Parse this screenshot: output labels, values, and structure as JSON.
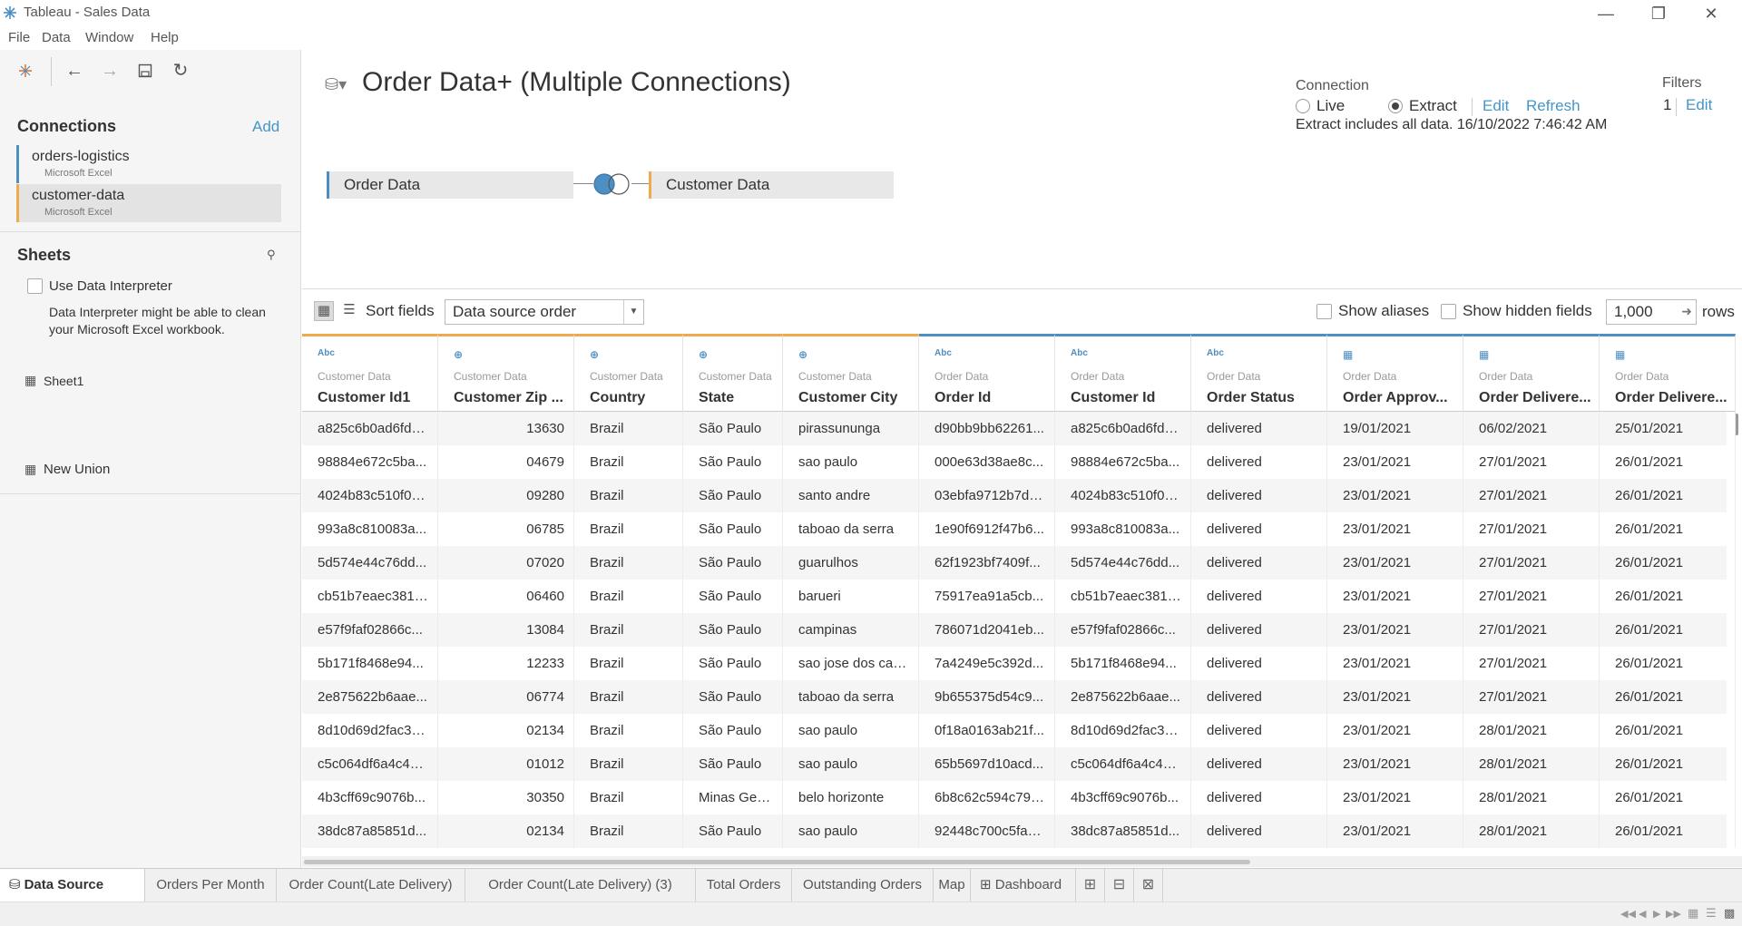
{
  "window": {
    "title": "Tableau - Sales Data",
    "minimize_icon": "minimize-icon",
    "maximize_icon": "restore-icon",
    "close_icon": "close-icon"
  },
  "menu": [
    "File",
    "Data",
    "Window",
    "Help"
  ],
  "left_panel": {
    "connections_title": "Connections",
    "add_label": "Add",
    "connections": [
      {
        "name": "orders-logistics",
        "type": "Microsoft Excel"
      },
      {
        "name": "customer-data",
        "type": "Microsoft Excel"
      }
    ],
    "sheets_title": "Sheets",
    "use_interpreter_label": "Use Data Interpreter",
    "interpreter_desc": "Data Interpreter might be able to clean your Microsoft Excel workbook.",
    "sheets": [
      "Sheet1"
    ],
    "new_union_label": "New Union"
  },
  "datasource": {
    "title": "Order Data+ (Multiple Connections)",
    "connection_label": "Connection",
    "live_label": "Live",
    "extract_label": "Extract",
    "selected_connection": "Extract",
    "edit_label": "Edit",
    "refresh_label": "Refresh",
    "extract_info": "Extract includes all data. 16/10/2022 7:46:42 AM",
    "filters_label": "Filters",
    "filters_count": "1",
    "filters_edit_label": "Edit",
    "join": {
      "left_table": "Order Data",
      "right_table": "Customer Data",
      "join_type": "left"
    }
  },
  "grid_toolbar": {
    "sort_label": "Sort fields",
    "sort_value": "Data source order",
    "show_aliases_label": "Show aliases",
    "show_hidden_label": "Show hidden fields",
    "rows_value": "1,000",
    "rows_label": "rows"
  },
  "grid": {
    "columns": [
      {
        "type": "Abc",
        "source": "Customer Data",
        "name": "Customer Id1"
      },
      {
        "type": "geo",
        "source": "Customer Data",
        "name": "Customer Zip ..."
      },
      {
        "type": "geo",
        "source": "Customer Data",
        "name": "Country"
      },
      {
        "type": "geo",
        "source": "Customer Data",
        "name": "State"
      },
      {
        "type": "geo",
        "source": "Customer Data",
        "name": "Customer City"
      },
      {
        "type": "Abc",
        "source": "Order Data",
        "name": "Order Id"
      },
      {
        "type": "Abc",
        "source": "Order Data",
        "name": "Customer Id"
      },
      {
        "type": "Abc",
        "source": "Order Data",
        "name": "Order Status"
      },
      {
        "type": "date",
        "source": "Order Data",
        "name": "Order Approv..."
      },
      {
        "type": "date",
        "source": "Order Data",
        "name": "Order Delivere..."
      },
      {
        "type": "date",
        "source": "Order Data",
        "name": "Order Delivere..."
      }
    ],
    "rows": [
      [
        "a825c6b0ad6fd2...",
        "13630",
        "Brazil",
        "São Paulo",
        "pirassununga",
        "d90bb9bb62261...",
        "a825c6b0ad6fd2...",
        "delivered",
        "19/01/2021",
        "06/02/2021",
        "25/01/2021"
      ],
      [
        "98884e672c5ba...",
        "04679",
        "Brazil",
        "São Paulo",
        "sao paulo",
        "000e63d38ae8c...",
        "98884e672c5ba...",
        "delivered",
        "23/01/2021",
        "27/01/2021",
        "26/01/2021"
      ],
      [
        "4024b83c510f00...",
        "09280",
        "Brazil",
        "São Paulo",
        "santo andre",
        "03ebfa9712b7db...",
        "4024b83c510f00...",
        "delivered",
        "23/01/2021",
        "27/01/2021",
        "26/01/2021"
      ],
      [
        "993a8c810083a...",
        "06785",
        "Brazil",
        "São Paulo",
        "taboao da serra",
        "1e90f6912f47b6...",
        "993a8c810083a...",
        "delivered",
        "23/01/2021",
        "27/01/2021",
        "26/01/2021"
      ],
      [
        "5d574e44c76dd...",
        "07020",
        "Brazil",
        "São Paulo",
        "guarulhos",
        "62f1923bf7409f...",
        "5d574e44c76dd...",
        "delivered",
        "23/01/2021",
        "27/01/2021",
        "26/01/2021"
      ],
      [
        "cb51b7eaec381b...",
        "06460",
        "Brazil",
        "São Paulo",
        "barueri",
        "75917ea91a5cb...",
        "cb51b7eaec381b...",
        "delivered",
        "23/01/2021",
        "27/01/2021",
        "26/01/2021"
      ],
      [
        "e57f9faf02866c...",
        "13084",
        "Brazil",
        "São Paulo",
        "campinas",
        "786071d2041eb...",
        "e57f9faf02866c...",
        "delivered",
        "23/01/2021",
        "27/01/2021",
        "26/01/2021"
      ],
      [
        "5b171f8468e94...",
        "12233",
        "Brazil",
        "São Paulo",
        "sao jose dos cam...",
        "7a4249e5c392d...",
        "5b171f8468e94...",
        "delivered",
        "23/01/2021",
        "27/01/2021",
        "26/01/2021"
      ],
      [
        "2e875622b6aae...",
        "06774",
        "Brazil",
        "São Paulo",
        "taboao da serra",
        "9b655375d54c9...",
        "2e875622b6aae...",
        "delivered",
        "23/01/2021",
        "27/01/2021",
        "26/01/2021"
      ],
      [
        "8d10d69d2fac34...",
        "02134",
        "Brazil",
        "São Paulo",
        "sao paulo",
        "0f18a0163ab21f...",
        "8d10d69d2fac34...",
        "delivered",
        "23/01/2021",
        "28/01/2021",
        "26/01/2021"
      ],
      [
        "c5c064df6a4c42...",
        "01012",
        "Brazil",
        "São Paulo",
        "sao paulo",
        "65b5697d10acd...",
        "c5c064df6a4c42...",
        "delivered",
        "23/01/2021",
        "28/01/2021",
        "26/01/2021"
      ],
      [
        "4b3cff69c9076b...",
        "30350",
        "Brazil",
        "Minas Gerais",
        "belo horizonte",
        "6b8c62c594c79c...",
        "4b3cff69c9076b...",
        "delivered",
        "23/01/2021",
        "28/01/2021",
        "26/01/2021"
      ],
      [
        "38dc87a85851d...",
        "02134",
        "Brazil",
        "São Paulo",
        "sao paulo",
        "92448c700c5fae...",
        "38dc87a85851d...",
        "delivered",
        "23/01/2021",
        "28/01/2021",
        "26/01/2021"
      ]
    ]
  },
  "tabs": {
    "data_source": "Data Source",
    "sheets": [
      "Orders Per Month",
      "Order Count(Late Delivery)",
      "Order Count(Late Delivery) (3)",
      "Total Orders",
      "Outstanding Orders",
      "Map"
    ],
    "dashboard": "Dashboard"
  },
  "colors": {
    "accent_link": "#4596c6",
    "order_data": "#4e8fc3",
    "customer_data": "#f0a94d"
  }
}
